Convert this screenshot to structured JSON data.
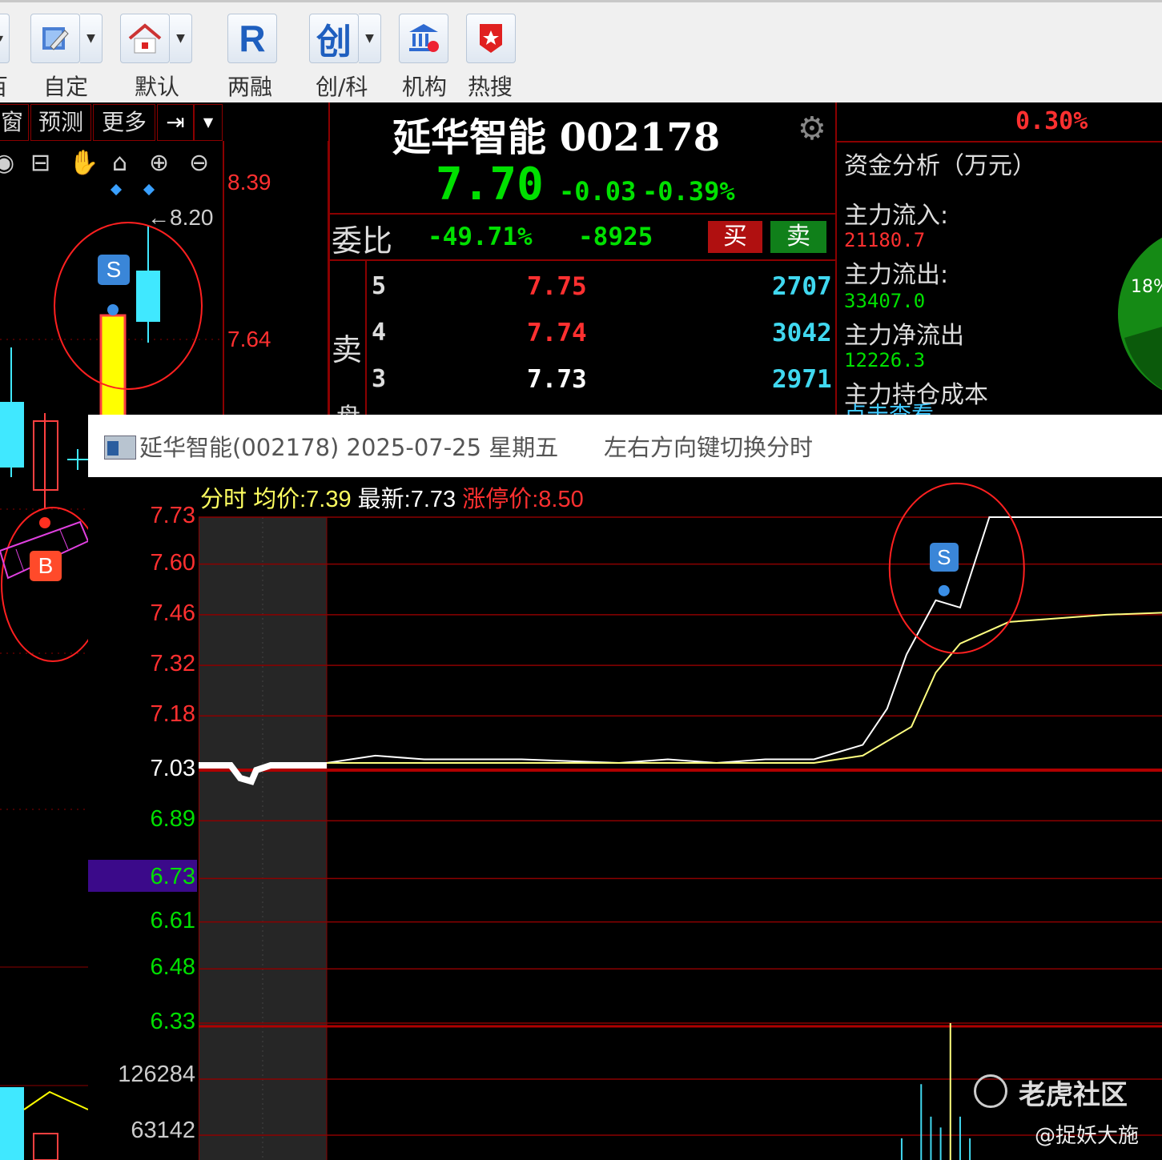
{
  "toolbar": {
    "buttons": [
      {
        "label": "自定",
        "icon": "edit-icon"
      },
      {
        "label": "默认",
        "icon": "home-icon"
      },
      {
        "label": "两融",
        "icon": "r-icon",
        "glyph": "R"
      },
      {
        "label": "创/科",
        "icon": "chuang-icon",
        "glyph": "创"
      },
      {
        "label": "机构",
        "icon": "bank-icon"
      },
      {
        "label": "热搜",
        "icon": "hot-search-icon"
      }
    ],
    "partial_label": "百"
  },
  "left_panel": {
    "tabs": [
      "窗",
      "预测",
      "更多",
      "⇥"
    ],
    "price_labels": [
      "8.39",
      "7.64"
    ],
    "arrow_label": "←8.20",
    "sell_marker": "S",
    "buy_marker": "B"
  },
  "quote": {
    "name_code": "延华智能 002178",
    "price": "7.70",
    "change": "-0.03",
    "change_pct": "-0.39%",
    "weibi_label": "委比",
    "weibi_pct": "-49.71%",
    "weicha": "-8925",
    "buy_label": "买",
    "sell_label": "卖",
    "sell_side_label": "卖",
    "sell_side_label2": "盘",
    "asks": [
      {
        "level": "5",
        "price": "7.75",
        "volume": "2707"
      },
      {
        "level": "4",
        "price": "7.74",
        "volume": "3042"
      },
      {
        "level": "3",
        "price": "7.73",
        "volume": "2971"
      }
    ]
  },
  "fund": {
    "pct": "0.30%",
    "title": "资金分析（万元）",
    "inflow_label": "主力流入:",
    "inflow_value": "21180.7",
    "outflow_label": "主力流出:",
    "outflow_value": "33407.0",
    "net_label": "主力净流出",
    "net_value": "12226.3",
    "cost_label": "主力持仓成本",
    "click_label": "点击查看",
    "pie_label": "18%"
  },
  "popup": {
    "title": "延华智能(002178) 2025-07-25 星期五",
    "hint": "左右方向键切换分时",
    "legend_fenshi": "分时",
    "legend_avg_label": "均价:",
    "legend_avg_value": "7.39",
    "legend_latest_label": "最新:",
    "legend_latest_value": "7.73",
    "legend_limit_label": "涨停价:",
    "legend_limit_value": "8.50",
    "y_labels": [
      {
        "text": "7.73",
        "color": "#ff3030"
      },
      {
        "text": "7.60",
        "color": "#ff3030"
      },
      {
        "text": "7.46",
        "color": "#ff3030"
      },
      {
        "text": "7.32",
        "color": "#ff3030"
      },
      {
        "text": "7.18",
        "color": "#ff3030"
      },
      {
        "text": "7.03",
        "color": "#ffffff"
      },
      {
        "text": "6.89",
        "color": "#00e000"
      },
      {
        "text": "6.73",
        "color": "#00e000"
      },
      {
        "text": "6.61",
        "color": "#00e000"
      },
      {
        "text": "6.48",
        "color": "#00e000"
      },
      {
        "text": "6.33",
        "color": "#00e000"
      }
    ],
    "vol_labels": [
      "126284",
      "63142"
    ],
    "marker": "S"
  },
  "watermark": {
    "brand": "老虎社区",
    "author": "@捉妖大施"
  },
  "chart_data": {
    "type": "line",
    "title": "",
    "xlabel": "",
    "ylabel": "",
    "ylim": [
      6.33,
      7.73
    ],
    "series": [
      {
        "name": "分时",
        "x": [
          0,
          10,
          20,
          40,
          60,
          70,
          80,
          90,
          100,
          110,
          115,
          119,
          125,
          130,
          136,
          150,
          170,
          200,
          240
        ],
        "values": [
          7.05,
          7.07,
          7.06,
          7.06,
          7.05,
          7.06,
          7.05,
          7.06,
          7.06,
          7.1,
          7.2,
          7.35,
          7.5,
          7.48,
          7.73,
          7.73,
          7.73,
          7.73,
          7.73
        ]
      },
      {
        "name": "均价",
        "x": [
          0,
          20,
          40,
          60,
          80,
          100,
          110,
          120,
          125,
          130,
          140,
          160,
          200,
          240
        ],
        "values": [
          7.05,
          7.05,
          7.05,
          7.05,
          7.05,
          7.05,
          7.07,
          7.15,
          7.3,
          7.38,
          7.44,
          7.46,
          7.48,
          7.5
        ]
      }
    ],
    "pre_market_value": 7.03,
    "volume": {
      "ylim": [
        0,
        126284
      ],
      "x": [
        118,
        122,
        124,
        126,
        128,
        130,
        132
      ],
      "values": [
        20000,
        70000,
        40000,
        30000,
        126284,
        40000,
        20000
      ]
    }
  }
}
